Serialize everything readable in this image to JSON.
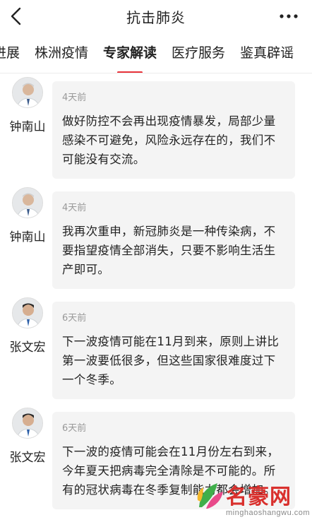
{
  "header": {
    "title": "抗击肺炎",
    "back_icon": "chevron-left-icon",
    "more_icon": "more-dots-icon"
  },
  "tabs": [
    {
      "label": "进展",
      "active": false
    },
    {
      "label": "株洲疫情",
      "active": false
    },
    {
      "label": "专家解读",
      "active": true
    },
    {
      "label": "医疗服务",
      "active": false
    },
    {
      "label": "鉴真辟谣",
      "active": false
    }
  ],
  "posts": [
    {
      "author": "钟南山",
      "time": "4天前",
      "content": "做好防控不会再出现疫情暴发，局部少量感染不可避免，风险永远存在的，我们不可能没有交流。"
    },
    {
      "author": "钟南山",
      "time": "4天前",
      "content": "我再次重申，新冠肺炎是一种传染病，不要指望疫情全部消失，只要不影响生活生产即可。"
    },
    {
      "author": "张文宏",
      "time": "6天前",
      "content": "下一波疫情可能在11月到来，原则上讲比第一波要低很多，但这些国家很难度过下一个冬季。"
    },
    {
      "author": "张文宏",
      "time": "6天前",
      "content": "下一波的疫情可能会在11月份左右到来，今年夏天把病毒完全清除是不可能的。所有的冠状病毒在冬季复制能力都会增加。"
    }
  ],
  "watermark": {
    "text": "名豪网",
    "url": "minghaoshangwu.com"
  },
  "colors": {
    "accent": "#e8333b",
    "bubble": "#f4f4f4",
    "time": "#999999"
  }
}
